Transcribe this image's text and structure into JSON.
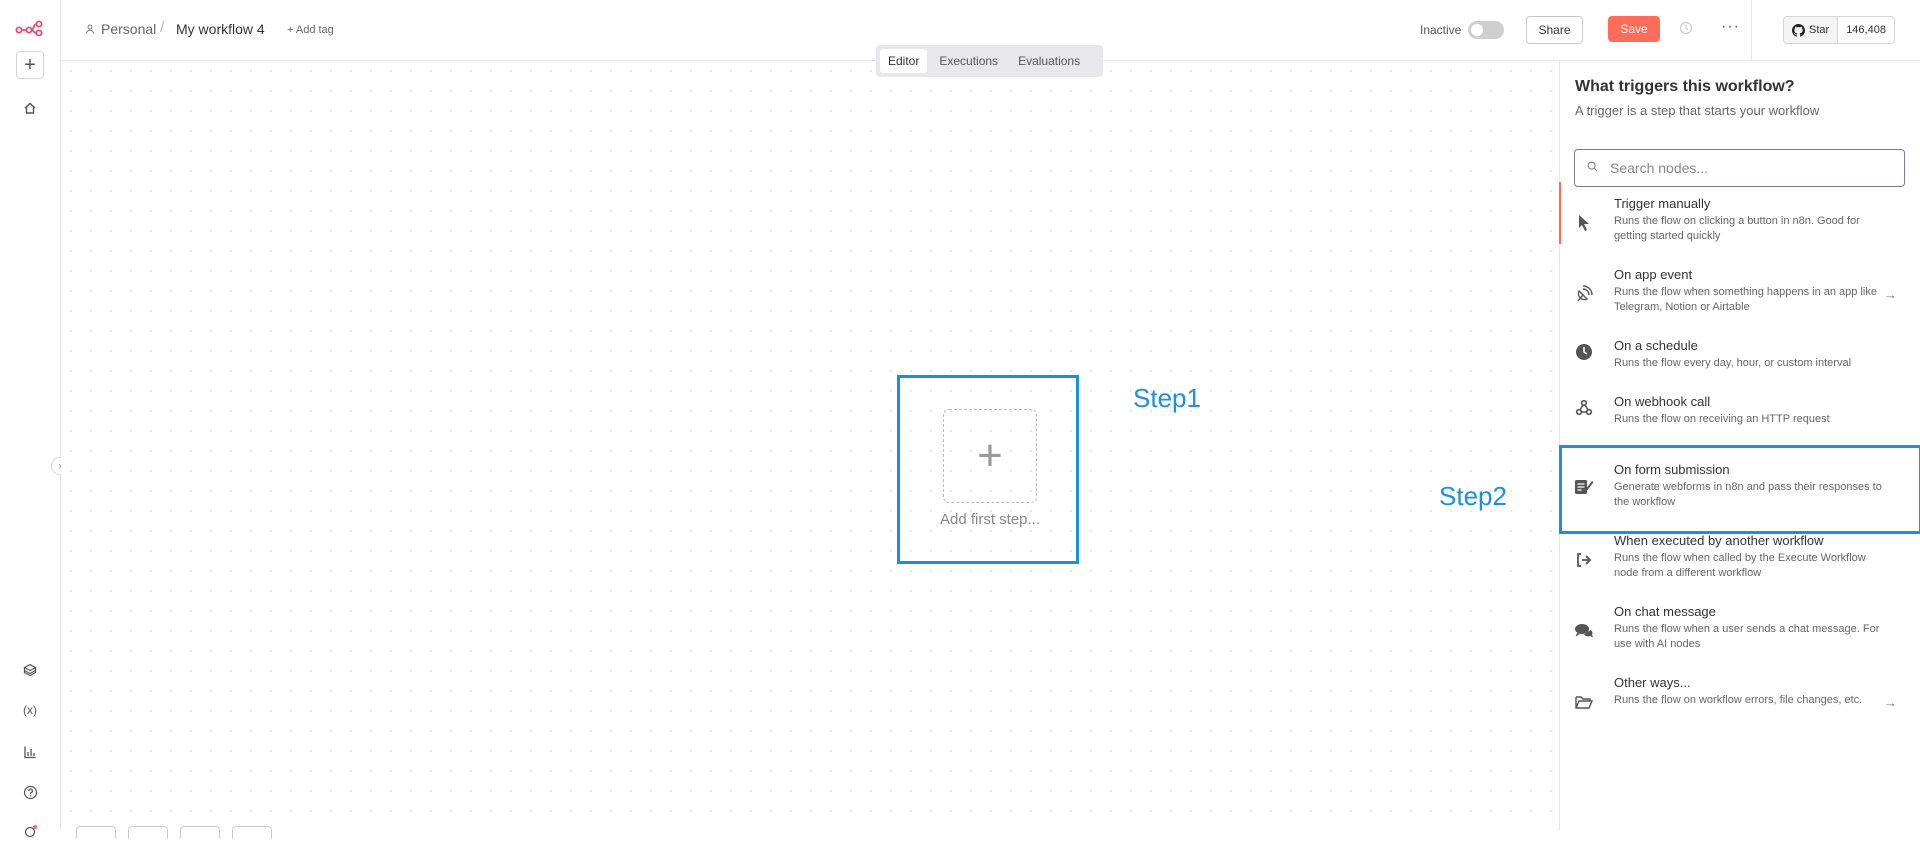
{
  "header": {
    "project": "Personal",
    "workflow_name": "My workflow 4",
    "add_tag": "+ Add tag",
    "status_label": "Inactive",
    "share_label": "Share",
    "save_label": "Save",
    "more_label": "···",
    "github_star": "Star",
    "github_count": "146,408"
  },
  "tabs": [
    "Editor",
    "Executions",
    "Evaluations"
  ],
  "canvas": {
    "add_first_step": "Add first step...",
    "plus": "+",
    "step1_annotation": "Step1",
    "step2_annotation": "Step2"
  },
  "panel": {
    "title": "What triggers this workflow?",
    "subtitle": "A trigger is a step that starts your workflow",
    "search_placeholder": "Search nodes...",
    "nodes": [
      {
        "title": "Trigger manually",
        "desc": "Runs the flow on clicking a button in n8n. Good for getting started quickly",
        "icon": "cursor-icon"
      },
      {
        "title": "On app event",
        "desc": "Runs the flow when something happens in an app like Telegram, Notion or Airtable",
        "icon": "satellite-dish-icon"
      },
      {
        "title": "On a schedule",
        "desc": "Runs the flow every day, hour, or custom interval",
        "icon": "clock-icon"
      },
      {
        "title": "On webhook call",
        "desc": "Runs the flow on receiving an HTTP request",
        "icon": "webhook-icon"
      },
      {
        "title": "On form submission",
        "desc": "Generate webforms in n8n and pass their responses to the workflow",
        "icon": "form-icon"
      },
      {
        "title": "When executed by another workflow",
        "desc": "Runs the flow when called by the Execute Workflow node from a different workflow",
        "icon": "sign-in-icon"
      },
      {
        "title": "On chat message",
        "desc": "Runs the flow when a user sends a chat message. For use with AI nodes",
        "icon": "comments-icon"
      },
      {
        "title": "Other ways...",
        "desc": "Runs the flow on workflow errors, file changes, etc.",
        "icon": "folder-open-icon"
      }
    ]
  },
  "colors": {
    "accent": "#ff6d5a",
    "annotation": "#1e8ede"
  }
}
